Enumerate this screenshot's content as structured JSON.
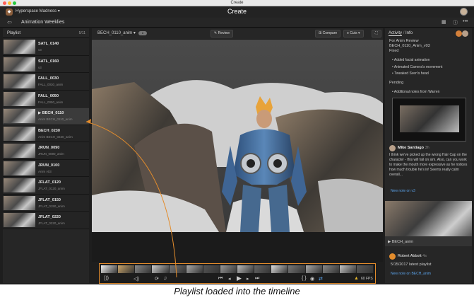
{
  "os": {
    "title": "Create"
  },
  "header": {
    "app_name": "Hyperspace Madness",
    "title": "Create"
  },
  "subheader": {
    "project": "Animation Weeklies"
  },
  "playlist": {
    "title": "Playlist",
    "count": "5/11",
    "items": [
      {
        "name": "SATL_0140",
        "sub": "v3"
      },
      {
        "name": "SATL_0160",
        "sub": "v3"
      },
      {
        "name": "FALL_0030",
        "sub": "FALL_0030_anim"
      },
      {
        "name": "FALL_0050",
        "sub": "FALL_0050_anim"
      },
      {
        "name": "BECH_0110",
        "sub": "Anim BECH_0110_anim"
      },
      {
        "name": "BECH_0230",
        "sub": "Anim BECH_0230_anim"
      },
      {
        "name": "JRUN_0090",
        "sub": "JRUN_0090_anim"
      },
      {
        "name": "JRUN_0100",
        "sub": "Anim v03"
      },
      {
        "name": "JFLAT_0120",
        "sub": "JFLAT_0120_anim"
      },
      {
        "name": "JFLAT_0150",
        "sub": "JFLAT_0150_anim"
      },
      {
        "name": "JFLAT_0220",
        "sub": "JFLAT_0220_anim"
      }
    ]
  },
  "viewer": {
    "shot": "BECH_0110_anim",
    "review_label": "Review",
    "compare_label": "Compare",
    "cuts_label": "Cuts"
  },
  "timeline": {
    "zoom": "60 FPS"
  },
  "activity": {
    "tab_activity": "Activity",
    "tab_info": "Info",
    "review_for": "For Anim Review",
    "version": "BECH_0110_Anim_v03",
    "status": "Fixed",
    "fixed_items": [
      "Added facial animation",
      "Animated Camera's movement",
      "Tweaked Sven's head"
    ],
    "pending_label": "Pending",
    "pending_items": [
      "Additional notes from Warren"
    ],
    "comment_author": "Mike Santiago",
    "comment_time": "3h",
    "comment_text": "I think we've picked up the wrong Hair Cap on the character - this will fail on sim. Also, can you work to make the mouth more expressive as he notices how much trouble he's in! Seems really calm overall...",
    "comment_link": "New note on v3",
    "shot_label": "BECH_anim",
    "second_author": "Robert Abbott",
    "second_time": "4s",
    "second_text": "5/15/2017 latest playlist",
    "second_link": "New note on BECH_anim"
  },
  "caption": "Playlist loaded into the timeline",
  "colors": {
    "accent": "#e38c2c",
    "link": "#5aa0e6"
  }
}
